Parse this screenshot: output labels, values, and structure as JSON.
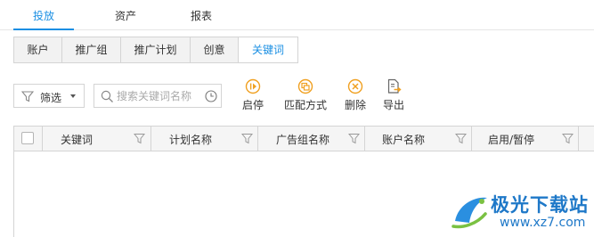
{
  "top_tabs": [
    {
      "label": "投放",
      "active": true
    },
    {
      "label": "资产",
      "active": false
    },
    {
      "label": "报表",
      "active": false
    }
  ],
  "level_tabs": [
    {
      "label": "账户",
      "active": false
    },
    {
      "label": "推广组",
      "active": false
    },
    {
      "label": "推广计划",
      "active": false
    },
    {
      "label": "创意",
      "active": false
    },
    {
      "label": "关键词",
      "active": true
    }
  ],
  "toolbar": {
    "filter_label": "筛选",
    "search_placeholder": "搜索关键词名称",
    "actions": [
      {
        "label": "启停",
        "icon": "start-stop-icon"
      },
      {
        "label": "匹配方式",
        "icon": "match-type-icon"
      },
      {
        "label": "删除",
        "icon": "delete-icon"
      },
      {
        "label": "导出",
        "icon": "export-icon"
      }
    ]
  },
  "table": {
    "columns": [
      "关键词",
      "计划名称",
      "广告组名称",
      "账户名称",
      "启用/暂停"
    ]
  },
  "watermark": {
    "title": "极光下载站",
    "url": "www.xz7.com"
  },
  "colors": {
    "accent": "#1a8fe3",
    "icon_orange": "#f0a020",
    "border": "#d4d4d4",
    "tab_bg": "#f2f2f2",
    "header_bg": "#f5f5f5"
  }
}
